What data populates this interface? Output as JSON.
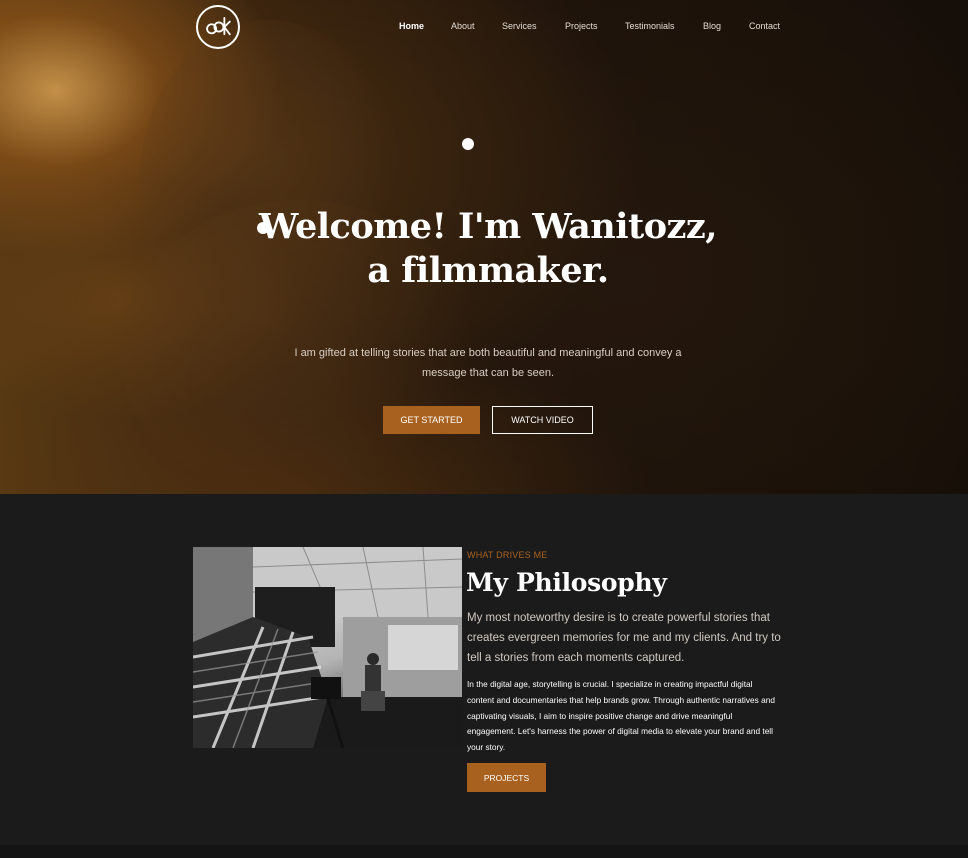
{
  "nav": {
    "items": [
      {
        "label": "Home",
        "active": true
      },
      {
        "label": "About"
      },
      {
        "label": "Services"
      },
      {
        "label": "Projects"
      },
      {
        "label": "Testimonials"
      },
      {
        "label": "Blog"
      },
      {
        "label": "Contact"
      }
    ]
  },
  "hero": {
    "title_line1": "Welcome! I'm Wanitozz,",
    "title_line2": "a filmmaker.",
    "subtitle": "I am gifted at telling stories that are both beautiful and meaningful and convey a message that can be seen.",
    "primary_button": "GET STARTED",
    "secondary_button": "WATCH VIDEO"
  },
  "philosophy": {
    "kicker": "WHAT DRIVES ME",
    "title": "My Philosophy",
    "lead": "My most noteworthy desire is to create powerful stories that creates evergreen memories for me and my clients. And try to tell a stories from each moments captured.",
    "body": "In the digital age, storytelling is crucial. I specialize in creating impactful digital content and documentaries that help brands grow. Through authentic narratives and captivating visuals, I aim to inspire positive change and drive meaningful engagement. Let's harness the power of digital media to elevate your brand and tell your story.",
    "button": "PROJECTS"
  },
  "colors": {
    "accent": "#a8611f",
    "section_bg": "#1c1b1b"
  }
}
